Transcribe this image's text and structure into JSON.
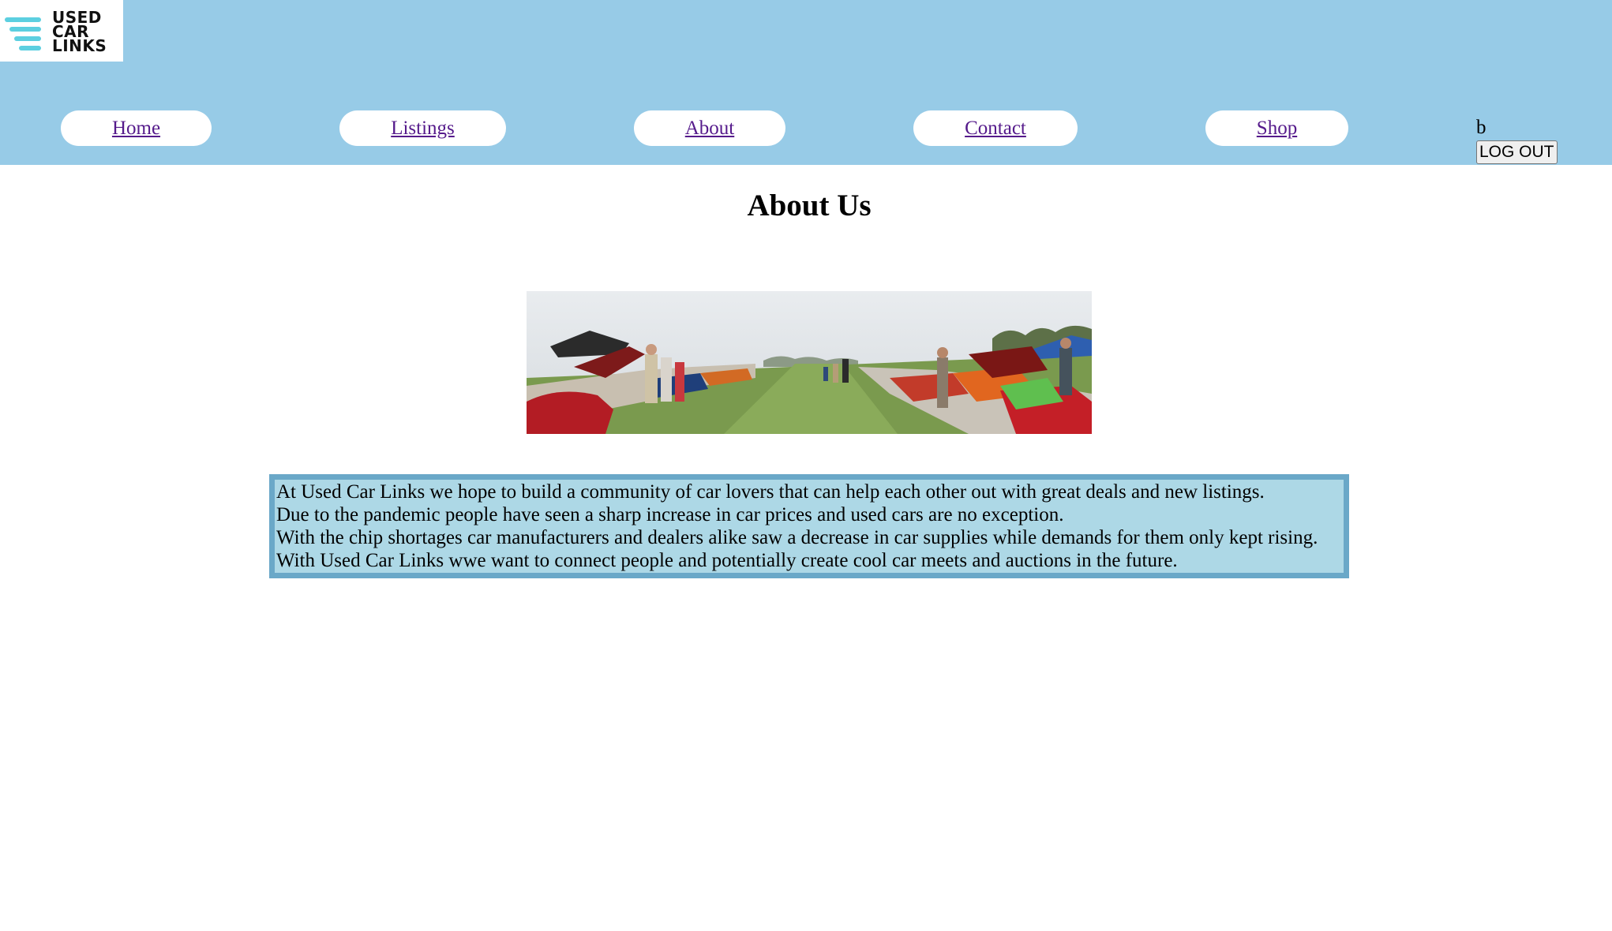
{
  "logo": {
    "line1": "USED",
    "line2": "CAR",
    "line3": "LINKS"
  },
  "nav": {
    "home": "Home",
    "listings": "Listings",
    "about": "About",
    "contact": "Contact",
    "shop": "Shop"
  },
  "user": {
    "name": "b",
    "logout_label": "LOG OUT"
  },
  "main": {
    "title": "About Us",
    "paragraph_lines": [
      "At Used Car Links we hope to build a community of car lovers that can help each other out with great deals and new listings.",
      "Due to the pandemic people have seen a sharp increase in car prices and used cars are no exception.",
      "With the chip shortages car manufacturers and dealers alike saw a decrease in car supplies while demands for them only kept rising.",
      "With Used Car Links wwe want to connect people and potentially create cool car meets and auctions in the future."
    ]
  },
  "colors": {
    "header_bg": "#97cbe7",
    "logo_accent": "#5ccfe0",
    "box_bg": "#add8e6",
    "box_border": "#6aa8c8",
    "link": "#551a8b"
  }
}
